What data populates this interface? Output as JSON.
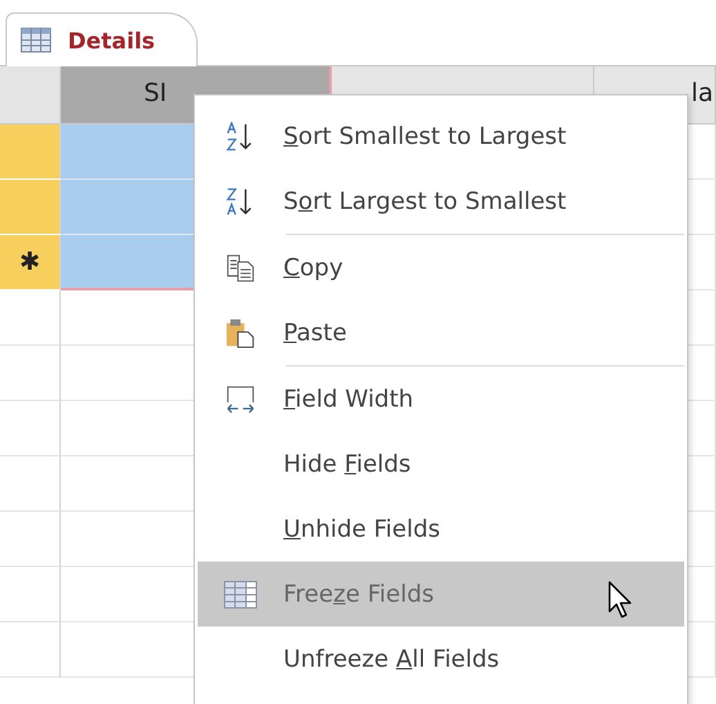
{
  "tab": {
    "label": "Details",
    "selected": true
  },
  "columns": [
    {
      "header": "SI",
      "selected": true
    },
    {
      "header": "la",
      "selected": false
    }
  ],
  "rows": [
    {
      "kind": "record"
    },
    {
      "kind": "record"
    },
    {
      "kind": "new",
      "marker": "✱"
    }
  ],
  "context_menu": [
    {
      "kind": "item",
      "key": "S",
      "after": "ort Smallest to Largest",
      "highlighted": false
    },
    {
      "kind": "item",
      "before": "S",
      "key": "o",
      "after": "rt Largest to Smallest",
      "highlighted": false
    },
    {
      "kind": "separator"
    },
    {
      "kind": "item",
      "key": "C",
      "after": "opy",
      "highlighted": false
    },
    {
      "kind": "item",
      "key": "P",
      "after": "aste",
      "highlighted": false
    },
    {
      "kind": "separator"
    },
    {
      "kind": "item",
      "key": "F",
      "after": "ield Width",
      "highlighted": false
    },
    {
      "kind": "item",
      "before": "Hide ",
      "key": "F",
      "after": "ields",
      "highlighted": false
    },
    {
      "kind": "item",
      "key": "U",
      "after": "nhide Fields",
      "highlighted": false
    },
    {
      "kind": "item",
      "before": "Free",
      "key": "z",
      "after": "e Fields",
      "highlighted": true
    },
    {
      "kind": "item",
      "before": "Unfreeze ",
      "key": "A",
      "after": "ll Fields",
      "highlighted": false
    }
  ]
}
